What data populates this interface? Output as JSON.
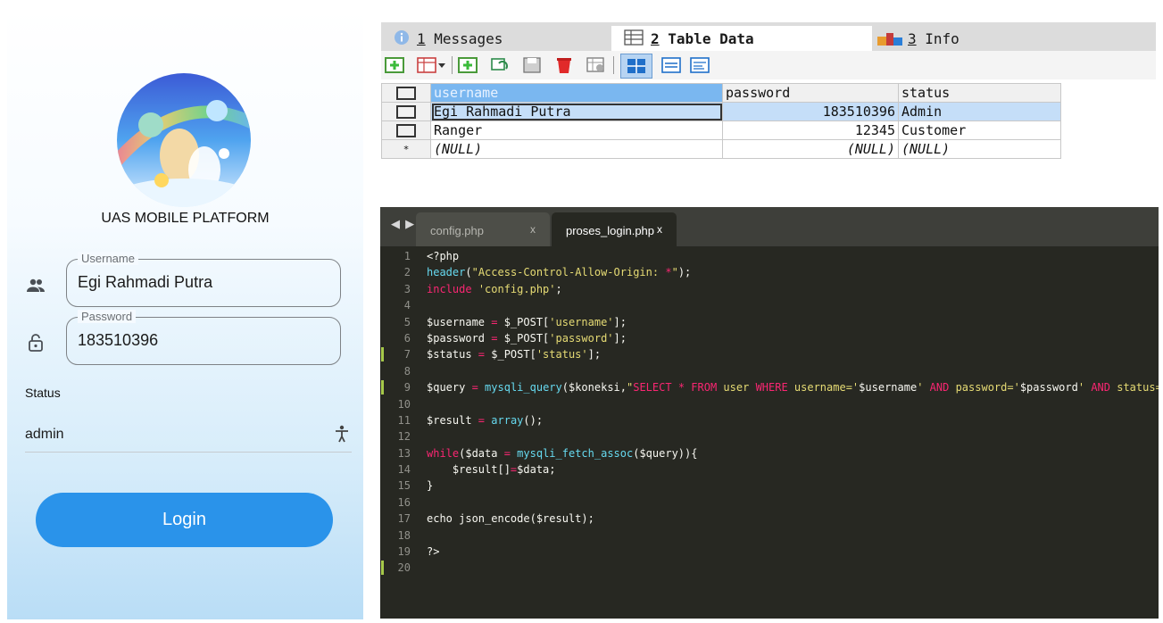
{
  "mobile": {
    "app_title": "UAS MOBILE PLATFORM",
    "username": {
      "label": "Username",
      "value": "Egi Rahmadi Putra",
      "icon": "people-icon"
    },
    "password": {
      "label": "Password",
      "value": "183510396",
      "icon": "lock-icon"
    },
    "status": {
      "label": "Status",
      "value": "admin",
      "icon": "accessibility-icon"
    },
    "login_button": "Login",
    "colors": {
      "button": "#2a93ea",
      "gradient_bottom": "#b9ddf6"
    }
  },
  "db_tool": {
    "tabs": [
      {
        "num": "1",
        "label": "Messages",
        "icon": "info-icon"
      },
      {
        "num": "2",
        "label": "Table Data",
        "icon": "table-icon",
        "active": true
      },
      {
        "num": "3",
        "label": "Info",
        "icon": "chart-icon"
      }
    ],
    "toolbar_icons": [
      "add-row-icon",
      "grid-dropdown-icon",
      "copy-row-icon",
      "refresh-icon",
      "save-icon",
      "delete-icon",
      "filter-icon",
      "grid-view-icon",
      "form-view-icon",
      "text-view-icon"
    ],
    "columns": [
      "username",
      "password",
      "status"
    ],
    "rows": [
      {
        "username": "Egi Rahmadi Putra",
        "password": "183510396",
        "status": "Admin"
      },
      {
        "username": "Ranger",
        "password": "12345",
        "status": "Customer"
      },
      {
        "username": "(NULL)",
        "password": "(NULL)",
        "status": "(NULL)"
      }
    ],
    "new_row_marker": "*"
  },
  "editor": {
    "nav_arrows": "◀ ▶",
    "tabs": [
      {
        "name": "config.php",
        "close": "x"
      },
      {
        "name": "proses_login.php",
        "close": "x",
        "active": true
      }
    ],
    "lines": [
      "<?php",
      "header(\"Access-Control-Allow-Origin: *\");",
      "include 'config.php';",
      "",
      "$username = $_POST['username'];",
      "$password = $_POST['password'];",
      "$status = $_POST['status'];",
      "",
      "$query = mysqli_query($koneksi,\"SELECT * FROM user WHERE username='$username' AND password='$password' AND status='$status' \");",
      "",
      "$result = array();",
      "",
      "while($data = mysqli_fetch_assoc($query)){",
      "    $result[]=$data;",
      "}",
      "",
      "echo json_encode($result);",
      "",
      "?>",
      ""
    ],
    "modified_lines": [
      7,
      9,
      20
    ],
    "colors": {
      "background": "#272822",
      "keyword": "#f92672",
      "function": "#66d9ef",
      "string": "#e6db74",
      "modified_marker": "#a6c94a"
    }
  }
}
